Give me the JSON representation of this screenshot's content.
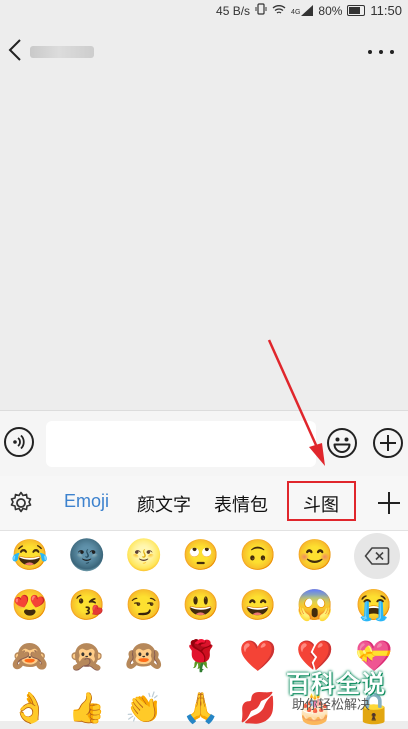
{
  "status_bar": {
    "net_speed": "45 B/s",
    "signal_label": "4G",
    "battery": "80%",
    "time": "11:50"
  },
  "nav_bar": {
    "title": "",
    "back_icon": "chevron-left-icon",
    "more_icon": "ellipsis-icon"
  },
  "input_bar": {
    "voice_icon": "voice-icon",
    "text_value": "",
    "emoji_icon": "smiley-icon",
    "plus_icon": "circle-plus-icon"
  },
  "keyboard": {
    "settings_icon": "gear-icon",
    "tabs": [
      {
        "label": "Emoji",
        "active": true
      },
      {
        "label": "颜文字",
        "active": false
      },
      {
        "label": "表情包",
        "active": false
      },
      {
        "label": "斗图",
        "active": false,
        "highlighted": true
      }
    ],
    "add_icon": "plus-icon",
    "delete_icon": "backspace-icon",
    "highlight_color": "#e0262c",
    "active_tab_color": "#3d82ce"
  },
  "emoji_rows": [
    [
      "😂",
      "🌚",
      "🌝",
      "🙄",
      "🙃",
      "😊"
    ],
    [
      "😍",
      "😘",
      "😏",
      "😃",
      "😄",
      "😱",
      "😭"
    ],
    [
      "🙈",
      "🙊",
      "🙉",
      "🌹",
      "❤️",
      "💔",
      "💝"
    ],
    [
      "👌",
      "👍",
      "👏",
      "🙏",
      "💋",
      "🎂",
      "🔒"
    ]
  ],
  "watermark": {
    "title": "百科全说",
    "subtitle": "助你轻松解决"
  }
}
